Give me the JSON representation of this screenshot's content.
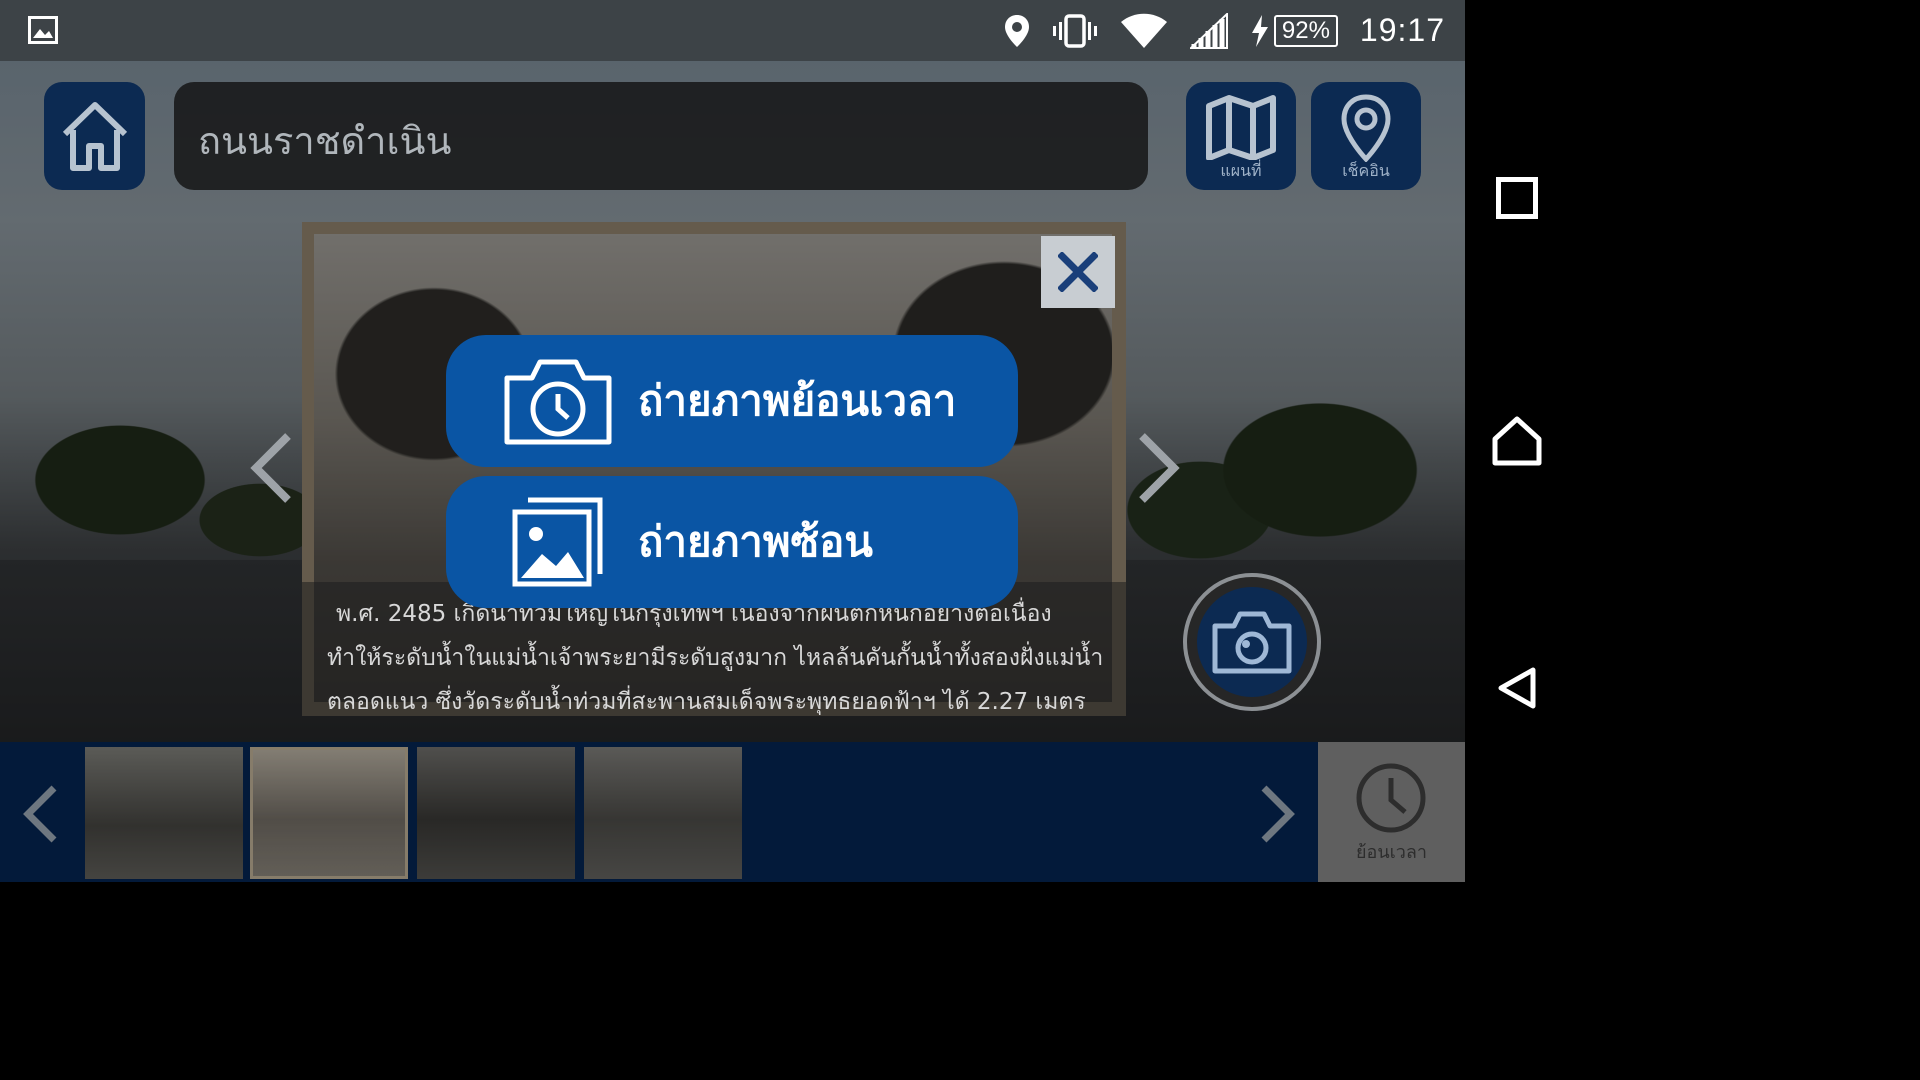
{
  "status_bar": {
    "battery_percent": "92%",
    "time": "19:17",
    "icons": [
      "gallery-icon",
      "location-icon",
      "vibrate-icon",
      "wifi-icon",
      "signal-icon",
      "charging-icon"
    ]
  },
  "header": {
    "search_text": "ถนนราชดำเนิน",
    "map_label": "แผนที่",
    "checkin_label": "เช็คอิน"
  },
  "menu": {
    "time_photo_label": "ถ่ายภาพย้อนเวลา",
    "overlay_photo_label": "ถ่ายภาพซ้อน"
  },
  "caption": {
    "line1": "พ.ศ. 2485 เกิดน้ำท่วมใหญ่ในกรุงเทพฯ เนื่องจากฝนตกหนักอย่างต่อเนื่อง",
    "line2": "ทำให้ระดับน้ำในแม่น้ำเจ้าพระยามีระดับสูงมาก ไหลล้นคันกั้นน้ำทั้งสองฝั่งแม่น้ำ",
    "line3": "ตลอดแนว ซึ่งวัดระดับน้ำท่วมที่สะพานสมเด็จพระพุทธยอดฟ้าฯ ได้ 2.27 เมตร"
  },
  "bottom_strip": {
    "thumbnail_count": 4,
    "selected_thumbnail": 2,
    "timeback_label": "ย้อนเวลา"
  },
  "colors": {
    "primary_blue": "#0a55a4",
    "dark_navy": "#0c2a52",
    "strip_navy": "#031a3a",
    "status_bar": "#3d4347"
  }
}
